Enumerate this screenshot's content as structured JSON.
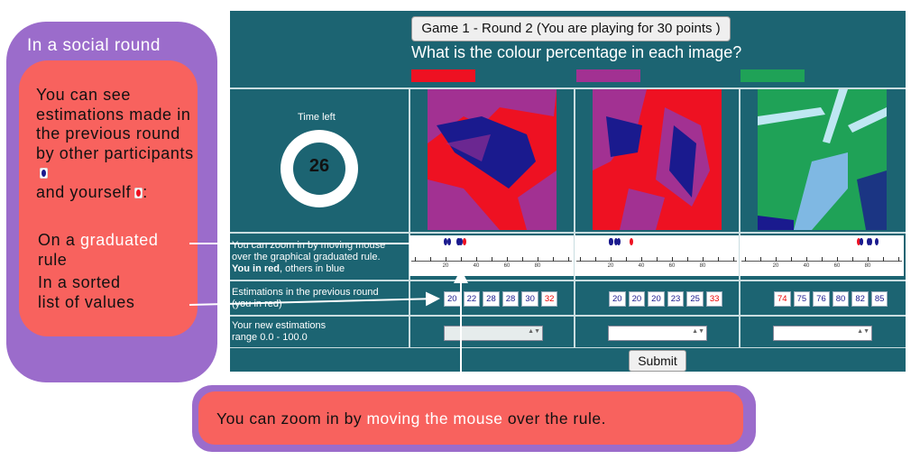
{
  "left_callout": {
    "title": "In a social round",
    "para_text": "You can see estimations made in the previous round by other participants",
    "para_end": "and yourself",
    "colon": ":",
    "graduated_pre": "On a ",
    "graduated_hl": "graduated",
    "graduated_post": "rule",
    "sorted_line1": "In a sorted",
    "sorted_line2": "list of values"
  },
  "game": {
    "title": "Game 1 - Round 2 (You are playing for 30 points )",
    "question": "What is the colour percentage in each image?",
    "swatches": [
      "#ee1122",
      "#a23192",
      "#1fa257"
    ],
    "time_label": "Time left",
    "time_value": "26",
    "zoom_text_1": "You can zoom in by moving mouse",
    "zoom_text_2": "over the graphical graduated rule.",
    "zoom_text_3a": "You in red",
    "zoom_text_3b": ", others in blue",
    "prev_label_1": "Estimations in the previous round",
    "prev_label_2": "(you in red)",
    "new_label_1": "Your new estimations",
    "new_label_2": "range 0.0 - 100.0",
    "tick_labels": [
      "20",
      "40",
      "60",
      "80"
    ],
    "estimates": [
      {
        "values": [
          "20",
          "22",
          "28",
          "28",
          "30",
          "32"
        ],
        "mine_index": 5
      },
      {
        "values": [
          "20",
          "20",
          "20",
          "23",
          "25",
          "33"
        ],
        "mine_index": 5
      },
      {
        "values": [
          "74",
          "75",
          "76",
          "80",
          "82",
          "85"
        ],
        "mine_index": 0
      }
    ],
    "submit_label": "Submit",
    "colors": {
      "panel": "#1c6472",
      "red": "#ee1122",
      "purple": "#a23192",
      "green": "#1fa257",
      "blue": "#1a1a8e"
    }
  },
  "bottom_callout": {
    "part1": "You can zoom in by ",
    "part2": "moving the mouse",
    "part3": " over the rule."
  }
}
